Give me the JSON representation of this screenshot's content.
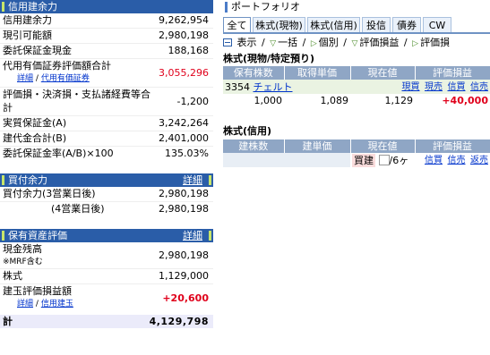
{
  "credit_capacity": {
    "title": "信用建余力",
    "rows": [
      {
        "label": "信用建余力",
        "value": "9,262,954"
      },
      {
        "label": "現引可能額",
        "value": "2,980,198"
      },
      {
        "label": "委託保証金現金",
        "value": "188,168"
      }
    ],
    "collateral": {
      "label": "代用有価証券評価額合計",
      "detail_link": "詳細",
      "sep": "/",
      "sub_link": "代用有価証券",
      "value": "3,055,296"
    },
    "loss": {
      "label": "評価損・決済損・支払諸経費等合計",
      "value": "-1,200"
    },
    "rows2": [
      {
        "label": "実質保証金(A)",
        "value": "3,242,264"
      },
      {
        "label": "建代金合計(B)",
        "value": "2,401,000"
      },
      {
        "label": "委託保証金率(A/B)×100",
        "value": "135.03%"
      }
    ]
  },
  "buying_power": {
    "title": "買付余力",
    "detail": "詳細",
    "rows": [
      {
        "label": "買付余力(3営業日後)",
        "value": "2,980,198"
      },
      {
        "label": "(4営業日後)",
        "value": "2,980,198"
      }
    ]
  },
  "asset_valuation": {
    "title": "保有資産評価",
    "detail": "詳細",
    "cash_label": "現金残高",
    "cash_note": "※MRF含む",
    "cash_value": "2,980,198",
    "stock_label": "株式",
    "stock_value": "1,129,000",
    "pl_label": "建玉評価損益額",
    "pl_detail": "詳細",
    "pl_sep": "/",
    "pl_link": "信用建玉",
    "pl_value": "+20,600",
    "total_label": "計",
    "total_value": "4,129,798"
  },
  "portfolio": {
    "title": "ポートフォリオ",
    "tabs": [
      "全て",
      "株式(現物)",
      "株式(信用)",
      "投信",
      "債券",
      "CW"
    ],
    "options": {
      "display": "表示",
      "sep1": "/",
      "lump": "一括",
      "sep2": "/",
      "individual": "個別",
      "sep3": "/",
      "pl": "評価損益",
      "sep4": "/",
      "pl2": "評価損"
    },
    "cash_section": {
      "title": "株式(現物/特定預り)",
      "headers": [
        "保有株数",
        "取得単価",
        "現在値",
        "評価損益"
      ],
      "stock_code": "3354",
      "stock_name": "チェルト",
      "actions": [
        "現買",
        "現売",
        "信買",
        "信売"
      ],
      "quantity": "1,000",
      "cost": "1,089",
      "price": "1,129",
      "pl": "+40,000"
    },
    "margin_section": {
      "title": "株式(信用)",
      "headers": [
        "建株数",
        "建単価",
        "現在値",
        "評価損益"
      ],
      "type": "買建",
      "qty_unit": "/6ヶ",
      "actions": [
        "信買",
        "信売",
        "返売"
      ]
    }
  },
  "colors": {
    "header_blue": "#2a5da8",
    "accent_green": "#c7e56a",
    "positive_red": "#e0001b",
    "table_header": "#8fa6c5",
    "row_green": "#eaf3e2"
  }
}
